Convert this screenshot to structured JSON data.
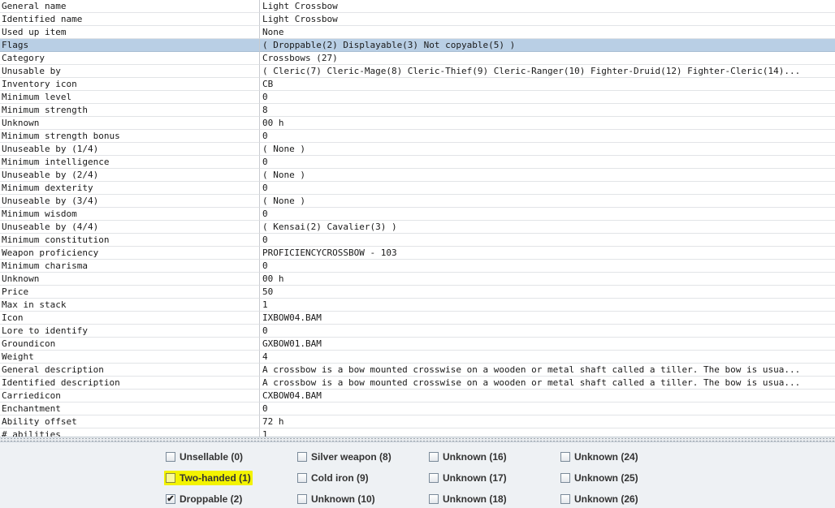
{
  "rows": [
    {
      "name": "General name",
      "value": "Light Crossbow"
    },
    {
      "name": "Identified name",
      "value": "Light Crossbow"
    },
    {
      "name": "Used up item",
      "value": "None"
    },
    {
      "name": "Flags",
      "value": "( Droppable(2) Displayable(3) Not copyable(5) )"
    },
    {
      "name": "Category",
      "value": "Crossbows (27)"
    },
    {
      "name": "Unusable by",
      "value": "( Cleric(7) Cleric-Mage(8) Cleric-Thief(9) Cleric-Ranger(10) Fighter-Druid(12) Fighter-Cleric(14)..."
    },
    {
      "name": "Inventory icon",
      "value": "CB"
    },
    {
      "name": "Minimum level",
      "value": "0"
    },
    {
      "name": "Minimum strength",
      "value": "8"
    },
    {
      "name": "Unknown",
      "value": "00 h"
    },
    {
      "name": "Minimum strength bonus",
      "value": "0"
    },
    {
      "name": "Unuseable by (1/4)",
      "value": "( None )"
    },
    {
      "name": "Minimum intelligence",
      "value": "0"
    },
    {
      "name": "Unuseable by (2/4)",
      "value": "( None )"
    },
    {
      "name": "Minimum dexterity",
      "value": "0"
    },
    {
      "name": "Unuseable by (3/4)",
      "value": "( None )"
    },
    {
      "name": "Minimum wisdom",
      "value": "0"
    },
    {
      "name": "Unuseable by (4/4)",
      "value": "( Kensai(2) Cavalier(3) )"
    },
    {
      "name": "Minimum constitution",
      "value": "0"
    },
    {
      "name": "Weapon proficiency",
      "value": "PROFICIENCYCROSSBOW - 103"
    },
    {
      "name": "Minimum charisma",
      "value": "0"
    },
    {
      "name": "Unknown",
      "value": "00 h"
    },
    {
      "name": "Price",
      "value": "50"
    },
    {
      "name": "Max in stack",
      "value": "1"
    },
    {
      "name": "Icon",
      "value": "IXBOW04.BAM"
    },
    {
      "name": "Lore to identify",
      "value": "0"
    },
    {
      "name": "Groundicon",
      "value": "GXBOW01.BAM"
    },
    {
      "name": "Weight",
      "value": "4"
    },
    {
      "name": "General description",
      "value": "A crossbow is a bow mounted crosswise on a wooden or metal shaft called a tiller. The bow is usua..."
    },
    {
      "name": "Identified description",
      "value": "A crossbow is a bow mounted crosswise on a wooden or metal shaft called a tiller. The bow is usua..."
    },
    {
      "name": "Carriedicon",
      "value": "CXBOW04.BAM"
    },
    {
      "name": "Enchantment",
      "value": "0"
    },
    {
      "name": "Ability offset",
      "value": "72 h"
    },
    {
      "name": "# abilities",
      "value": "1"
    }
  ],
  "selected_row": 3,
  "flags": [
    {
      "label": "Unsellable (0)",
      "checked": false
    },
    {
      "label": "Two-handed (1)",
      "checked": false,
      "highlighted": true
    },
    {
      "label": "Droppable (2)",
      "checked": true
    },
    {
      "label": "Silver weapon (8)",
      "checked": false
    },
    {
      "label": "Cold iron (9)",
      "checked": false
    },
    {
      "label": "Unknown (10)",
      "checked": false
    },
    {
      "label": "Unknown (16)",
      "checked": false
    },
    {
      "label": "Unknown (17)",
      "checked": false
    },
    {
      "label": "Unknown (18)",
      "checked": false
    },
    {
      "label": "Unknown (24)",
      "checked": false
    },
    {
      "label": "Unknown (25)",
      "checked": false
    },
    {
      "label": "Unknown (26)",
      "checked": false
    }
  ],
  "check_glyph": "✔",
  "colors": {
    "selection": "#b9cfe5",
    "highlight": "#f3f300"
  }
}
